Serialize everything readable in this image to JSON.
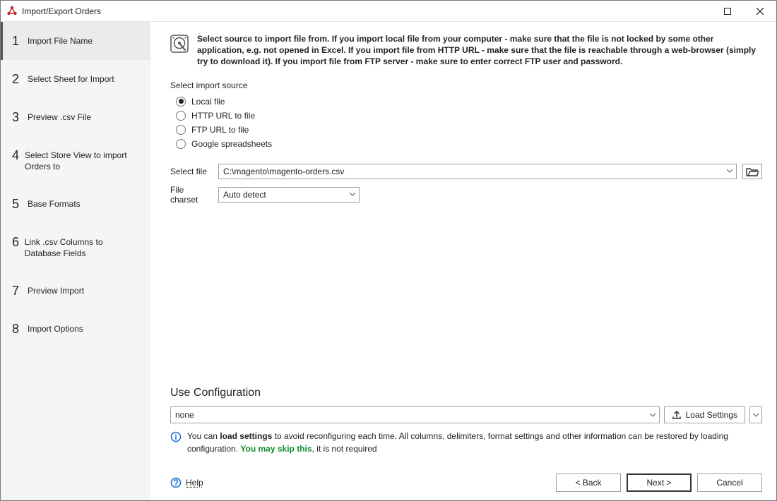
{
  "window": {
    "title": "Import/Export Orders"
  },
  "sidebar": {
    "steps": [
      {
        "num": "1",
        "label": "Import File Name"
      },
      {
        "num": "2",
        "label": "Select Sheet for Import"
      },
      {
        "num": "3",
        "label": "Preview .csv File"
      },
      {
        "num": "4",
        "label": "Select Store View to import Orders to"
      },
      {
        "num": "5",
        "label": "Base Formats"
      },
      {
        "num": "6",
        "label": "Link .csv Columns to Database Fields"
      },
      {
        "num": "7",
        "label": "Preview Import"
      },
      {
        "num": "8",
        "label": "Import Options"
      }
    ],
    "active_index": 0
  },
  "intro_text": "Select source to import file from. If you import local file from your computer - make sure that the file is not locked by some other application, e.g. not opened in Excel. If you import file from HTTP URL - make sure that the file is reachable through a web-browser (simply try to download it). If you import file from FTP server - make sure to enter correct FTP user and password.",
  "source": {
    "label": "Select import source",
    "options": [
      "Local file",
      "HTTP URL to file",
      "FTP URL to file",
      "Google spreadsheets"
    ],
    "selected_index": 0
  },
  "file": {
    "label": "Select file",
    "value": "C:\\magento\\magento-orders.csv"
  },
  "charset": {
    "label": "File charset",
    "value": "Auto detect"
  },
  "use_config": {
    "heading": "Use Configuration",
    "value": "none",
    "load_button": "Load Settings",
    "info_prefix": "You can ",
    "info_bold": "load settings",
    "info_mid": " to avoid reconfiguring each time. All columns, delimiters, format settings and other information can be restored by loading configuration. ",
    "info_green": "You may skip this",
    "info_tail": ", it is not required"
  },
  "footer": {
    "help": "Help",
    "back": "< Back",
    "next": "Next >",
    "cancel": "Cancel"
  }
}
